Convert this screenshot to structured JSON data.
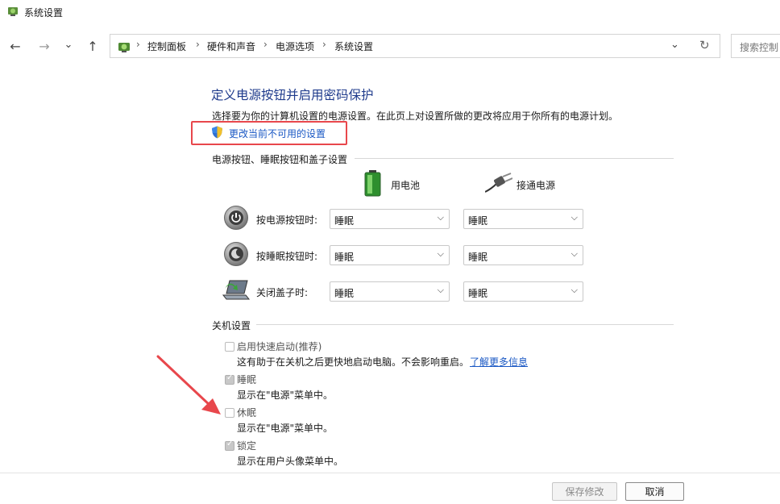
{
  "window": {
    "title": "系统设置"
  },
  "nav": {
    "back": "←",
    "forward": "→",
    "recent": "⌄",
    "up": "↑",
    "dropdown": "⌄",
    "refresh": "↻"
  },
  "breadcrumb": [
    "控制面板",
    "硬件和声音",
    "电源选项",
    "系统设置"
  ],
  "search": {
    "placeholder": "搜索控制"
  },
  "main": {
    "title": "定义电源按钮并启用密码保护",
    "description": "选择要为你的计算机设置的电源设置。在此页上对设置所做的更改将应用于你所有的电源计划。",
    "change_link": "更改当前不可用的设置"
  },
  "power_section": {
    "heading": "电源按钮、睡眠按钮和盖子设置",
    "columns": [
      "用电池",
      "接通电源"
    ],
    "rows": [
      {
        "label": "按电源按钮时:",
        "battery": "睡眠",
        "plugged": "睡眠",
        "icon": "power-icon"
      },
      {
        "label": "按睡眠按钮时:",
        "battery": "睡眠",
        "plugged": "睡眠",
        "icon": "sleep-moon-icon"
      },
      {
        "label": "关闭盖子时:",
        "battery": "睡眠",
        "plugged": "睡眠",
        "icon": "laptop-lid-icon"
      }
    ]
  },
  "shutdown_section": {
    "heading": "关机设置",
    "options": [
      {
        "label": "启用快速启动(推荐)",
        "desc": "这有助于在关机之后更快地启动电脑。不会影响重启。",
        "link": "了解更多信息",
        "checked": false
      },
      {
        "label": "睡眠",
        "desc": "显示在\"电源\"菜单中。",
        "checked": true
      },
      {
        "label": "休眠",
        "desc": "显示在\"电源\"菜单中。",
        "checked": false
      },
      {
        "label": "锁定",
        "desc": "显示在用户头像菜单中。",
        "checked": true
      }
    ]
  },
  "footer": {
    "save": "保存修改",
    "cancel": "取消"
  },
  "colors": {
    "title_blue": "#1f3b8c",
    "link_blue": "#1a58c4",
    "highlight_red": "#e8474c",
    "arrow_red": "#e8474c"
  }
}
